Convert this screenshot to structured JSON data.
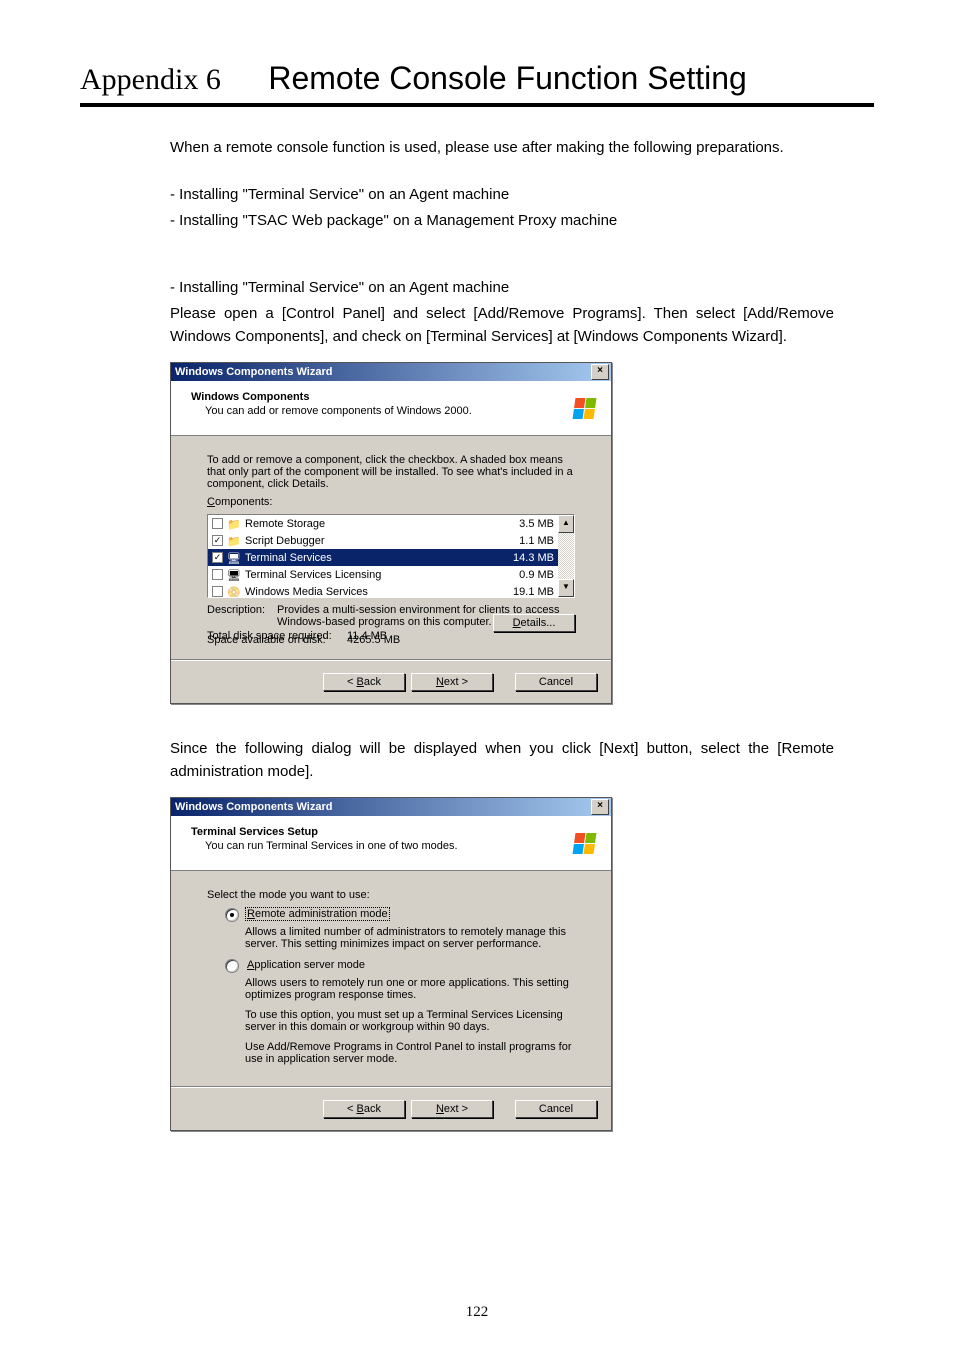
{
  "page_number": "122",
  "heading": {
    "appendix": "Appendix 6",
    "title": "Remote Console Function Setting"
  },
  "intro": {
    "p1": "When a remote console function is used, please use after making the following preparations.",
    "b1": "- Installing \"Terminal Service\" on an Agent machine",
    "b2": "- Installing \"TSAC Web package\" on a Management Proxy machine",
    "p2a": "- Installing \"Terminal Service\" on an Agent machine",
    "p2b": "Please open a [Control Panel] and select [Add/Remove Programs].  Then select [Add/Remove Windows Components], and check on [Terminal Services] at [Windows Components Wizard]."
  },
  "dialog1": {
    "title": "Windows Components Wizard",
    "close": "×",
    "banner_title": "Windows Components",
    "banner_sub": "You can add or remove components of Windows 2000.",
    "instr": "To add or remove a component, click the checkbox. A shaded box means that only part of the component will be installed. To see what's included in a component, click Details.",
    "components_label": "Components:",
    "components": [
      {
        "checked": false,
        "name": "Remote Storage",
        "size": "3.5 MB"
      },
      {
        "checked": true,
        "name": "Script Debugger",
        "size": "1.1 MB"
      },
      {
        "checked": true,
        "name": "Terminal Services",
        "size": "14.3 MB",
        "selected": true
      },
      {
        "checked": false,
        "name": "Terminal Services Licensing",
        "size": "0.9 MB"
      },
      {
        "checked": false,
        "name": "Windows Media Services",
        "size": "19.1 MB"
      }
    ],
    "desc_label": "Description:",
    "desc_text": "Provides a multi-session environment for clients to access Windows-based programs on this computer.",
    "disk_req_label": "Total disk space required:",
    "disk_req_val": "11.4 MB",
    "disk_avail_label": "Space available on disk:",
    "disk_avail_val": "4265.5 MB",
    "details_btn": "Details...",
    "back_btn": "< Back",
    "next_btn": "Next >",
    "cancel_btn": "Cancel"
  },
  "mid_text": "Since the following dialog will be displayed when you click [Next] button, select the [Remote administration mode].",
  "dialog2": {
    "title": "Windows Components Wizard",
    "close": "×",
    "banner_title": "Terminal Services Setup",
    "banner_sub": "You can run Terminal Services in one of two modes.",
    "select_label": "Select the mode you want to use:",
    "opt1_label": "Remote administration mode",
    "opt1_desc": "Allows a limited number of administrators to remotely manage this server. This setting minimizes impact on server performance.",
    "opt2_label": "Application server mode",
    "opt2_desc1": "Allows users to remotely run one or more applications. This setting optimizes program response times.",
    "opt2_desc2": "To use this option, you must set up a Terminal Services Licensing server in this domain or workgroup within 90 days.",
    "opt2_desc3": "Use Add/Remove Programs in Control Panel to install programs for use in application server mode.",
    "back_btn": "< Back",
    "next_btn": "Next >",
    "cancel_btn": "Cancel"
  }
}
